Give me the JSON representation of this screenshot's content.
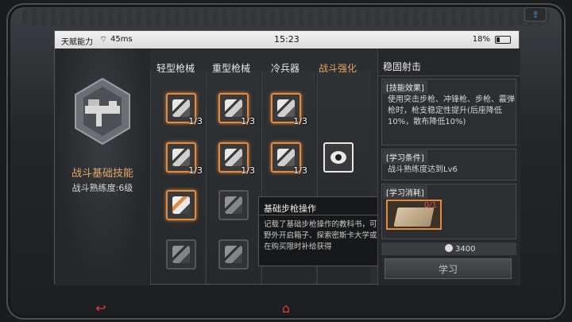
{
  "statusbar": {
    "carrier": "天赋能力",
    "ping": "45ms",
    "time": "15:23",
    "battery": "18%"
  },
  "skill": {
    "name": "战斗基础技能",
    "level": "战斗熟练度:6级"
  },
  "tabs": [
    {
      "label": "轻型枪械",
      "active": false
    },
    {
      "label": "重型枪械",
      "active": false
    },
    {
      "label": "冷兵器",
      "active": false
    },
    {
      "label": "战斗强化",
      "active": true
    }
  ],
  "nodes": {
    "count_label": "1/3"
  },
  "tooltip": {
    "title": "基础步枪操作",
    "description": "记载了基础步枪操作的教科书，可在野外开启箱子、探索密斯卡大学或者在购买限时补给获得"
  },
  "detail": {
    "title": "稳固射击",
    "effect_header": "[技能效果]",
    "effect_text": "使用突击步枪、冲锋枪、步枪、霰弹枪时，枪支稳定性提升(后座降低10%，散布降低10%)",
    "condition_header": "[学习条件]",
    "condition_text": "战斗熟练度达到Lv6",
    "cost_header": "[学习消耗]",
    "item_qty": "0/1",
    "gold_cost": "3400",
    "learn_label": "学习"
  },
  "colors": {
    "accent": "#e38a3e",
    "warning": "#e94a3a"
  }
}
